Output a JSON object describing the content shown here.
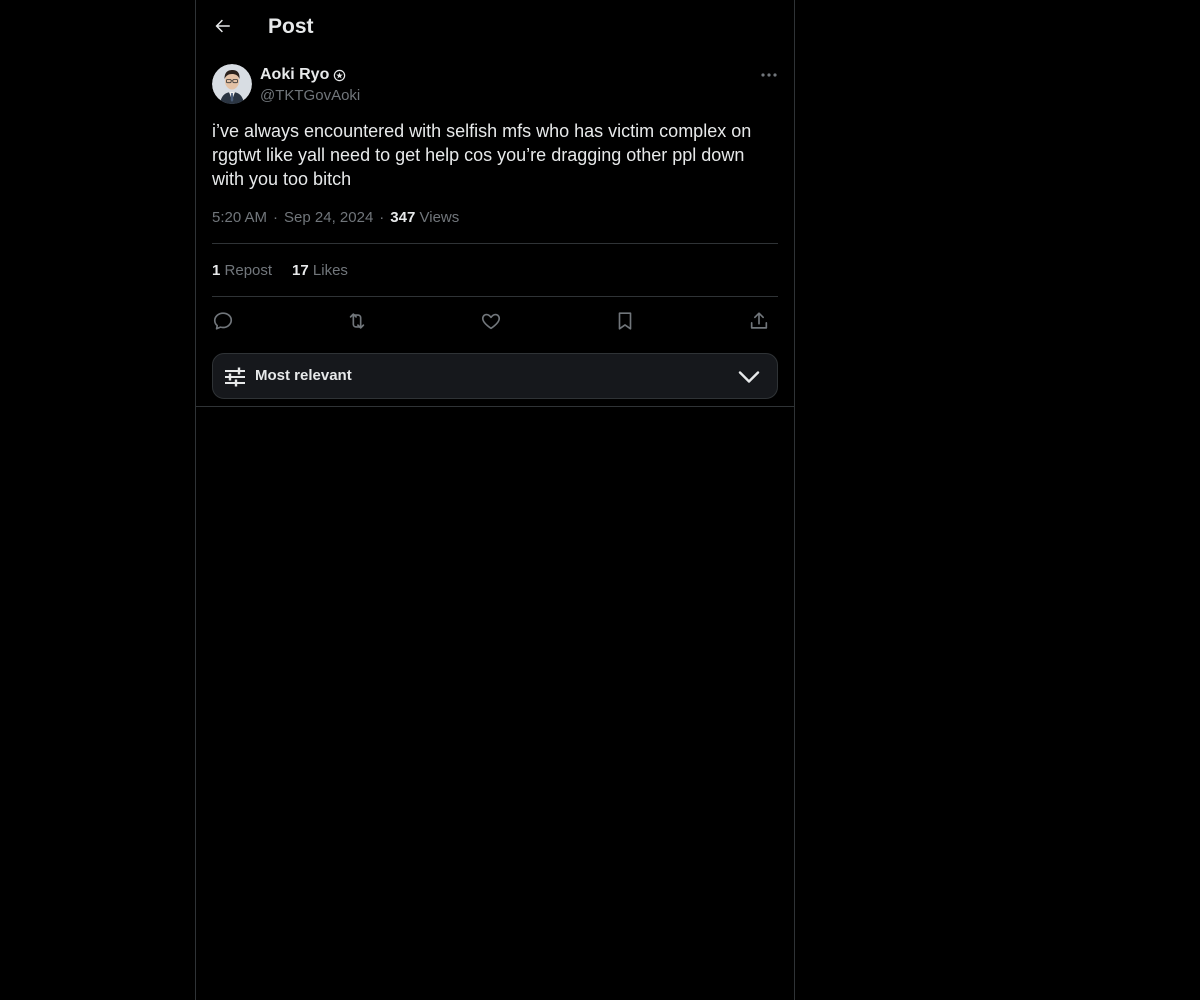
{
  "header": {
    "title": "Post",
    "back_icon": "arrow-left-icon"
  },
  "post": {
    "author_name": "Aoki Ryo",
    "author_handle": "@TKTGovAoki",
    "badge_icon": "verified-badge-icon",
    "text": "i’ve always encountered with selfish mfs who has victim complex on rggtwt like yall need to get help cos you’re dragging other ppl down with you too bitch",
    "time": "5:20 AM",
    "date": "Sep 24, 2024",
    "views_count": "347",
    "views_label": "Views",
    "separator": "·"
  },
  "stats": {
    "reposts_count": "1",
    "reposts_label": "Repost",
    "likes_count": "17",
    "likes_label": "Likes"
  },
  "actions": [
    "reply-icon",
    "repost-icon",
    "like-icon",
    "bookmark-icon",
    "share-icon"
  ],
  "sort": {
    "label": "Most relevant",
    "icon": "sliders-icon",
    "chevron": "chevron-down-icon"
  },
  "colors": {
    "background": "#000000",
    "text_primary": "#e7e9ea",
    "text_secondary": "#71767b",
    "border": "#2f3336",
    "sort_bar_bg": "#16181c"
  }
}
